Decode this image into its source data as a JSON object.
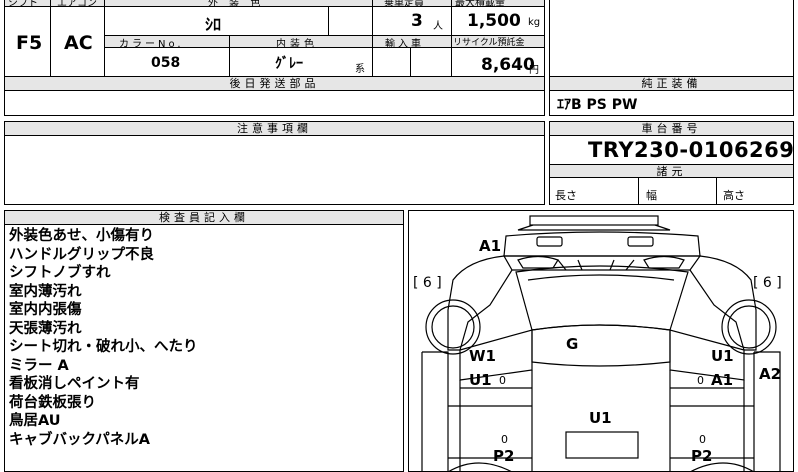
{
  "top_table": {
    "shift_header": "シフト",
    "aircon_header": "エアコン",
    "exterior_color_header": "外 装 色",
    "capacity_header": "乗車定員",
    "max_load_header": "最大積載量",
    "shift_value": "F5",
    "aircon_value": "AC",
    "exterior_color_value": "ｼﾛ",
    "capacity_value": "3",
    "capacity_unit": "人",
    "max_load_value": "1,500",
    "max_load_unit": "kg",
    "color_no_header": "カラーNo.",
    "interior_color_header": "内装色",
    "import_header": "輸入車",
    "recycle_header": "リサイクル預託金",
    "color_no_value": "058",
    "interior_color_value": "ｸﾞﾚｰ",
    "interior_color_suffix": "系",
    "recycle_value": "8,640",
    "recycle_unit": "円"
  },
  "later_parts": {
    "header": "後日発送部品",
    "value": ""
  },
  "genuine_equipment": {
    "header": "純正装備",
    "value": "ｴｱB PS PW"
  },
  "notes": {
    "header": "注意事項欄",
    "value": ""
  },
  "chassis": {
    "header": "車台番号",
    "value": "TRY230-0106269",
    "specs_header": "諸元",
    "length_label": "長さ",
    "width_label": "幅",
    "height_label": "高さ"
  },
  "inspector": {
    "header": "検査員記入欄",
    "remarks": [
      "外装色あせ、小傷有り",
      "ハンドルグリップ不良",
      "シフトノブすれ",
      "室内薄汚れ",
      "室内内張傷",
      "天張薄汚れ",
      "シート切れ・破れ小、へたり",
      "ミラー A",
      "看板消しペイント有",
      "荷台鉄板張り",
      "鳥居AU",
      "キャブバックパネルA"
    ]
  },
  "diagram_marks": {
    "a1_top": "A1",
    "bracket_left": "[ 6 ]",
    "bracket_right": "[ 6 ]",
    "g": "G",
    "w1": "W1",
    "u1_left": "U1",
    "u1_right": "U1",
    "a1_right": "A1",
    "a2": "A2",
    "u1_bed": "U1",
    "p2_left": "P2",
    "p2_right": "P2",
    "zero": "0"
  }
}
